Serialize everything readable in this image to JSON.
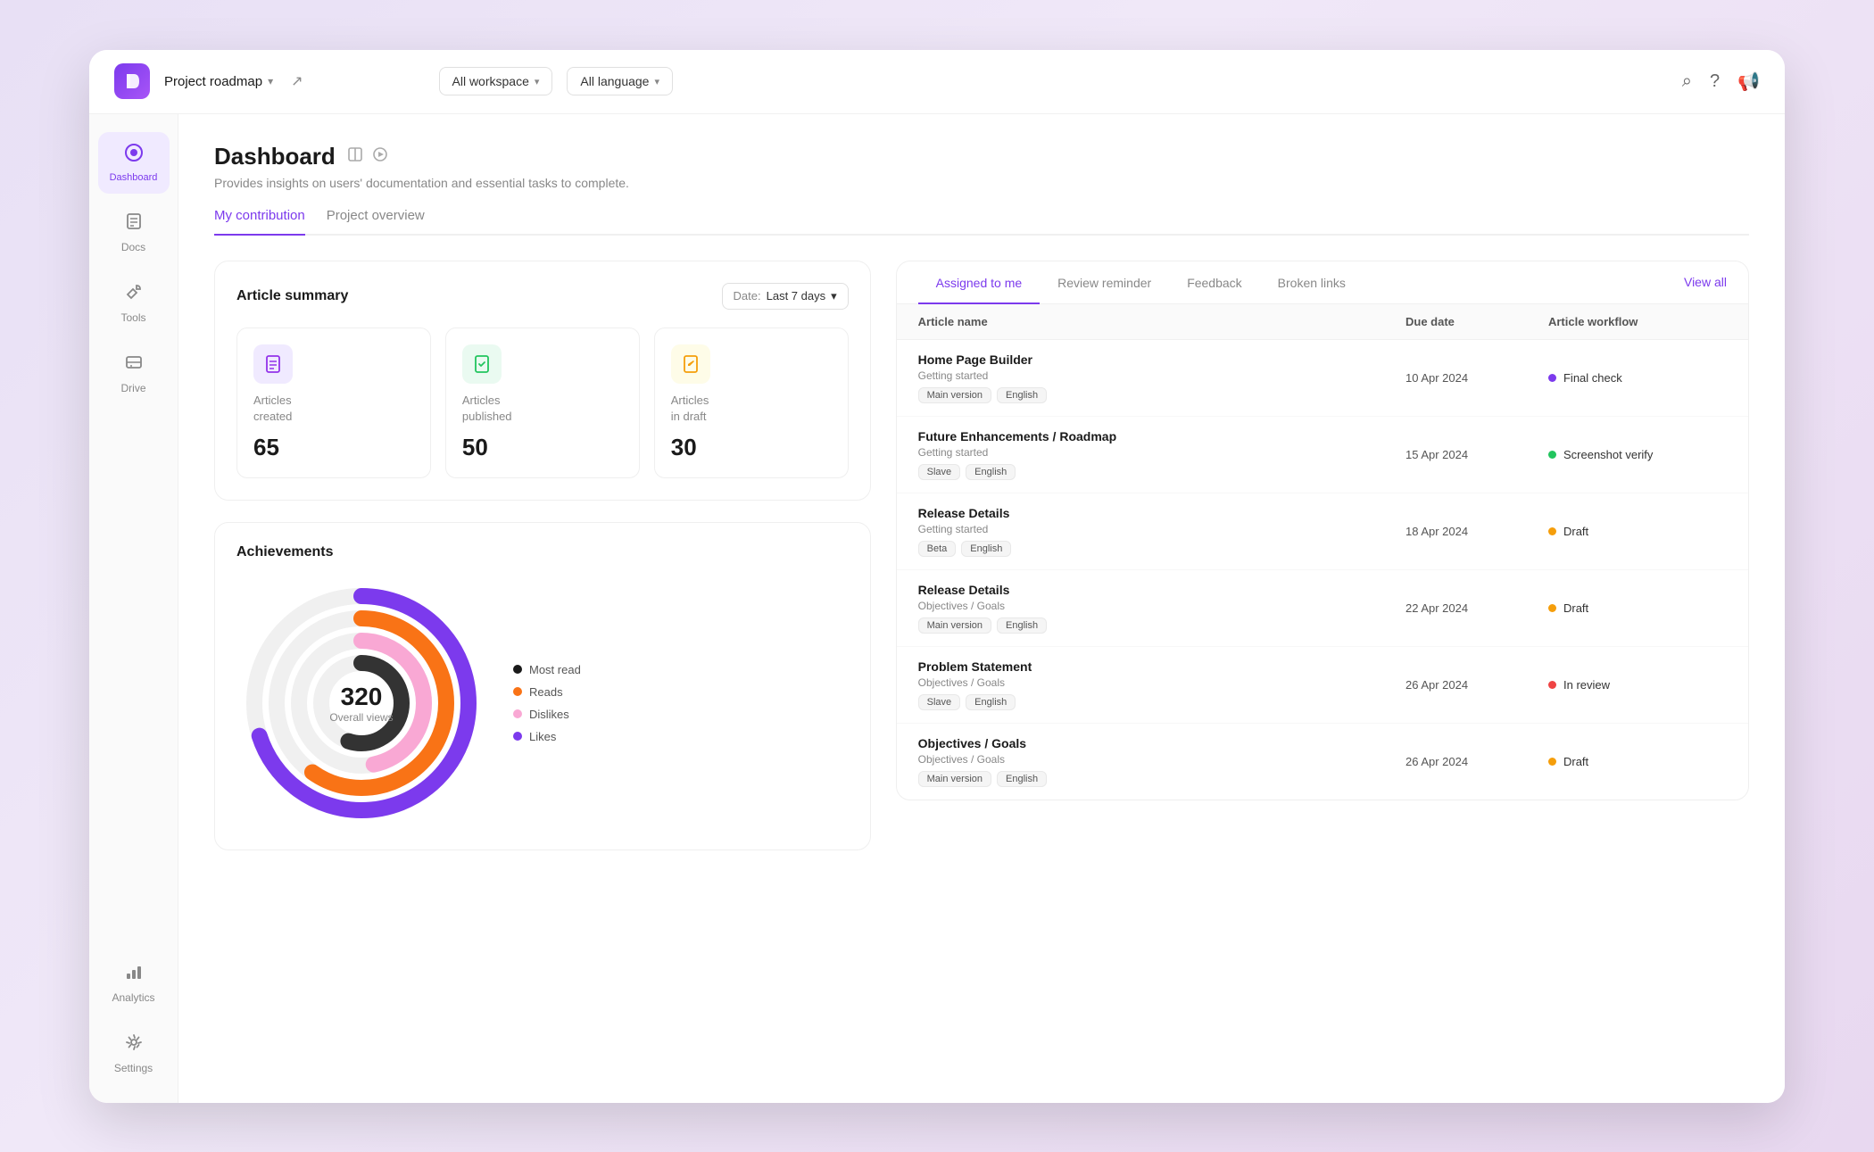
{
  "topbar": {
    "logo": "D",
    "project_name": "Project roadmap",
    "workspace_label": "All workspace",
    "language_label": "All language",
    "external_link": "↗",
    "arrow": "▾"
  },
  "sidebar": {
    "items": [
      {
        "id": "dashboard",
        "label": "Dashboard",
        "icon": "🏠",
        "active": true
      },
      {
        "id": "docs",
        "label": "Docs",
        "icon": "📚",
        "active": false
      },
      {
        "id": "tools",
        "label": "Tools",
        "icon": "🔧",
        "active": false
      },
      {
        "id": "drive",
        "label": "Drive",
        "icon": "🗂",
        "active": false
      },
      {
        "id": "analytics",
        "label": "Analytics",
        "icon": "📊",
        "active": false
      },
      {
        "id": "settings",
        "label": "Settings",
        "icon": "⚙️",
        "active": false
      }
    ]
  },
  "page": {
    "title": "Dashboard",
    "subtitle": "Provides insights on users' documentation and essential tasks to complete.",
    "tabs": [
      {
        "id": "my-contribution",
        "label": "My contribution",
        "active": true
      },
      {
        "id": "project-overview",
        "label": "Project overview",
        "active": false
      }
    ]
  },
  "article_summary": {
    "title": "Article summary",
    "date_label": "Date:",
    "date_value": "Last 7 days",
    "stats": [
      {
        "id": "created",
        "icon": "📄",
        "icon_color": "purple",
        "label": "Articles\ncreated",
        "value": "65"
      },
      {
        "id": "published",
        "icon": "📋",
        "icon_color": "green",
        "label": "Articles\npublished",
        "value": "50"
      },
      {
        "id": "draft",
        "icon": "📝",
        "icon_color": "yellow",
        "label": "Articles\nin draft",
        "value": "30"
      }
    ]
  },
  "achievements": {
    "title": "Achievements",
    "chart": {
      "value": "320",
      "label": "Overall views"
    },
    "legend": [
      {
        "label": "Most read",
        "color": "#1a1a1a"
      },
      {
        "label": "Reads",
        "color": "#f97316"
      },
      {
        "label": "Dislikes",
        "color": "#f9a8d4"
      },
      {
        "label": "Likes",
        "color": "#7c3aed"
      }
    ]
  },
  "right_panel": {
    "tabs": [
      {
        "id": "assigned",
        "label": "Assigned to me",
        "active": true
      },
      {
        "id": "review",
        "label": "Review reminder",
        "active": false
      },
      {
        "id": "feedback",
        "label": "Feedback",
        "active": false
      },
      {
        "id": "broken",
        "label": "Broken links",
        "active": false
      }
    ],
    "view_all": "View all",
    "columns": [
      {
        "id": "name",
        "label": "Article name"
      },
      {
        "id": "due",
        "label": "Due date"
      },
      {
        "id": "workflow",
        "label": "Article workflow"
      }
    ],
    "rows": [
      {
        "name": "Home Page Builder",
        "category": "Getting started",
        "tags": [
          "Main version",
          "English"
        ],
        "due_date": "10 Apr 2024",
        "workflow": "Final check",
        "workflow_color": "dot-purple"
      },
      {
        "name": "Future Enhancements / Roadmap",
        "category": "Getting started",
        "tags": [
          "Slave",
          "English"
        ],
        "due_date": "15 Apr 2024",
        "workflow": "Screenshot verify",
        "workflow_color": "dot-green"
      },
      {
        "name": "Release Details",
        "category": "Getting started",
        "tags": [
          "Beta",
          "English"
        ],
        "due_date": "18 Apr 2024",
        "workflow": "Draft",
        "workflow_color": "dot-orange"
      },
      {
        "name": "Release Details",
        "category": "Objectives / Goals",
        "tags": [
          "Main version",
          "English"
        ],
        "due_date": "22 Apr 2024",
        "workflow": "Draft",
        "workflow_color": "dot-orange"
      },
      {
        "name": "Problem Statement",
        "category": "Objectives / Goals",
        "tags": [
          "Slave",
          "English"
        ],
        "due_date": "26 Apr 2024",
        "workflow": "In review",
        "workflow_color": "dot-red"
      },
      {
        "name": "Objectives / Goals",
        "category": "Objectives / Goals",
        "tags": [
          "Main version",
          "English"
        ],
        "due_date": "26 Apr 2024",
        "workflow": "Draft",
        "workflow_color": "dot-orange"
      }
    ]
  }
}
